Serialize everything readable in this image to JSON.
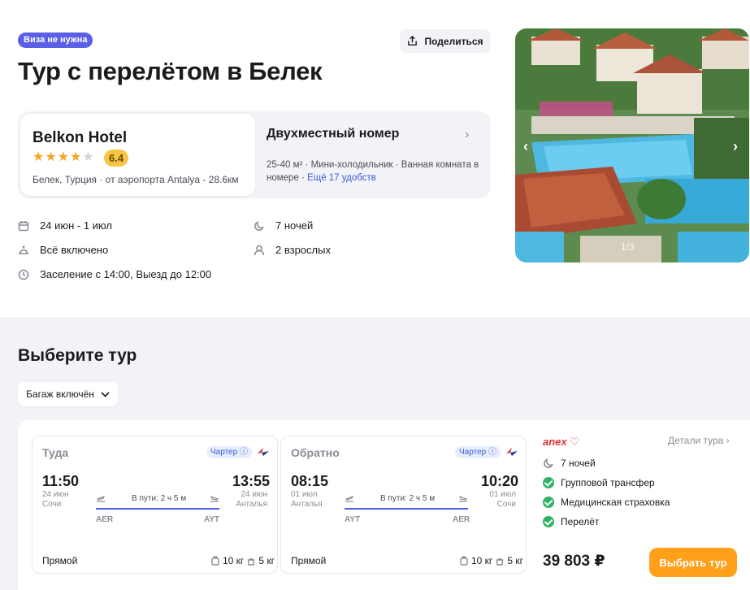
{
  "header": {
    "visa_badge": "Виза не нужна",
    "share_label": "Поделиться",
    "title": "Тур с перелётом в Белек"
  },
  "hotel": {
    "name": "Belkon Hotel",
    "stars": 4,
    "stars_max": 5,
    "rating": "6.4",
    "location": "Белек, Турция · от аэропорта Antalya - 28.6км",
    "room_title": "Двухместный номер",
    "room_desc": "25-40 м² · Мини-холодильник · Ванная комната в номере · ",
    "room_more": "Ещё 17 удобств"
  },
  "facts": {
    "dates": "24 июн - 1 июл",
    "nights": "7 ночей",
    "meal": "Всё включено",
    "guests": "2 взрослых",
    "checkin": "Заселение с 14:00, Выезд до 12:00"
  },
  "photo": {
    "counter": "1/3",
    "prev": "‹",
    "next": "›"
  },
  "tours": {
    "section_title": "Выберите тур",
    "filter_label": "Багаж включён",
    "outbound": {
      "label": "Туда",
      "charter": "Чартер",
      "dep_time": "11:50",
      "dep_date": "24 июн",
      "dep_city": "Сочи",
      "duration": "В пути: 2 ч 5 м",
      "dep_iata": "AER",
      "arr_iata": "AYT",
      "arr_time": "13:55",
      "arr_date": "24 июн",
      "arr_city": "Анталья",
      "type": "Прямой",
      "bag": "10 кг",
      "hand": "5 кг"
    },
    "return": {
      "label": "Обратно",
      "charter": "Чартер",
      "dep_time": "08:15",
      "dep_date": "01 июл",
      "dep_city": "Анталья",
      "duration": "В пути: 2 ч 5 м",
      "dep_iata": "AYT",
      "arr_iata": "AER",
      "arr_time": "10:20",
      "arr_date": "01 июл",
      "arr_city": "Сочи",
      "type": "Прямой",
      "bag": "10 кг",
      "hand": "5 кг"
    },
    "offer": {
      "operator": "anex",
      "details": "Детали тура",
      "nights": "7 ночей",
      "inclusions": [
        "Групповой трансфер",
        "Медицинская страховка",
        "Перелёт"
      ],
      "price": "39 803 ₽",
      "choose_label": "Выбрать тур"
    }
  },
  "colors": {
    "accent": "#4c5ee0",
    "badge": "#5a5fe6",
    "cta": "#ff9f1a",
    "rating": "#f6c544",
    "check": "#2fb463"
  }
}
